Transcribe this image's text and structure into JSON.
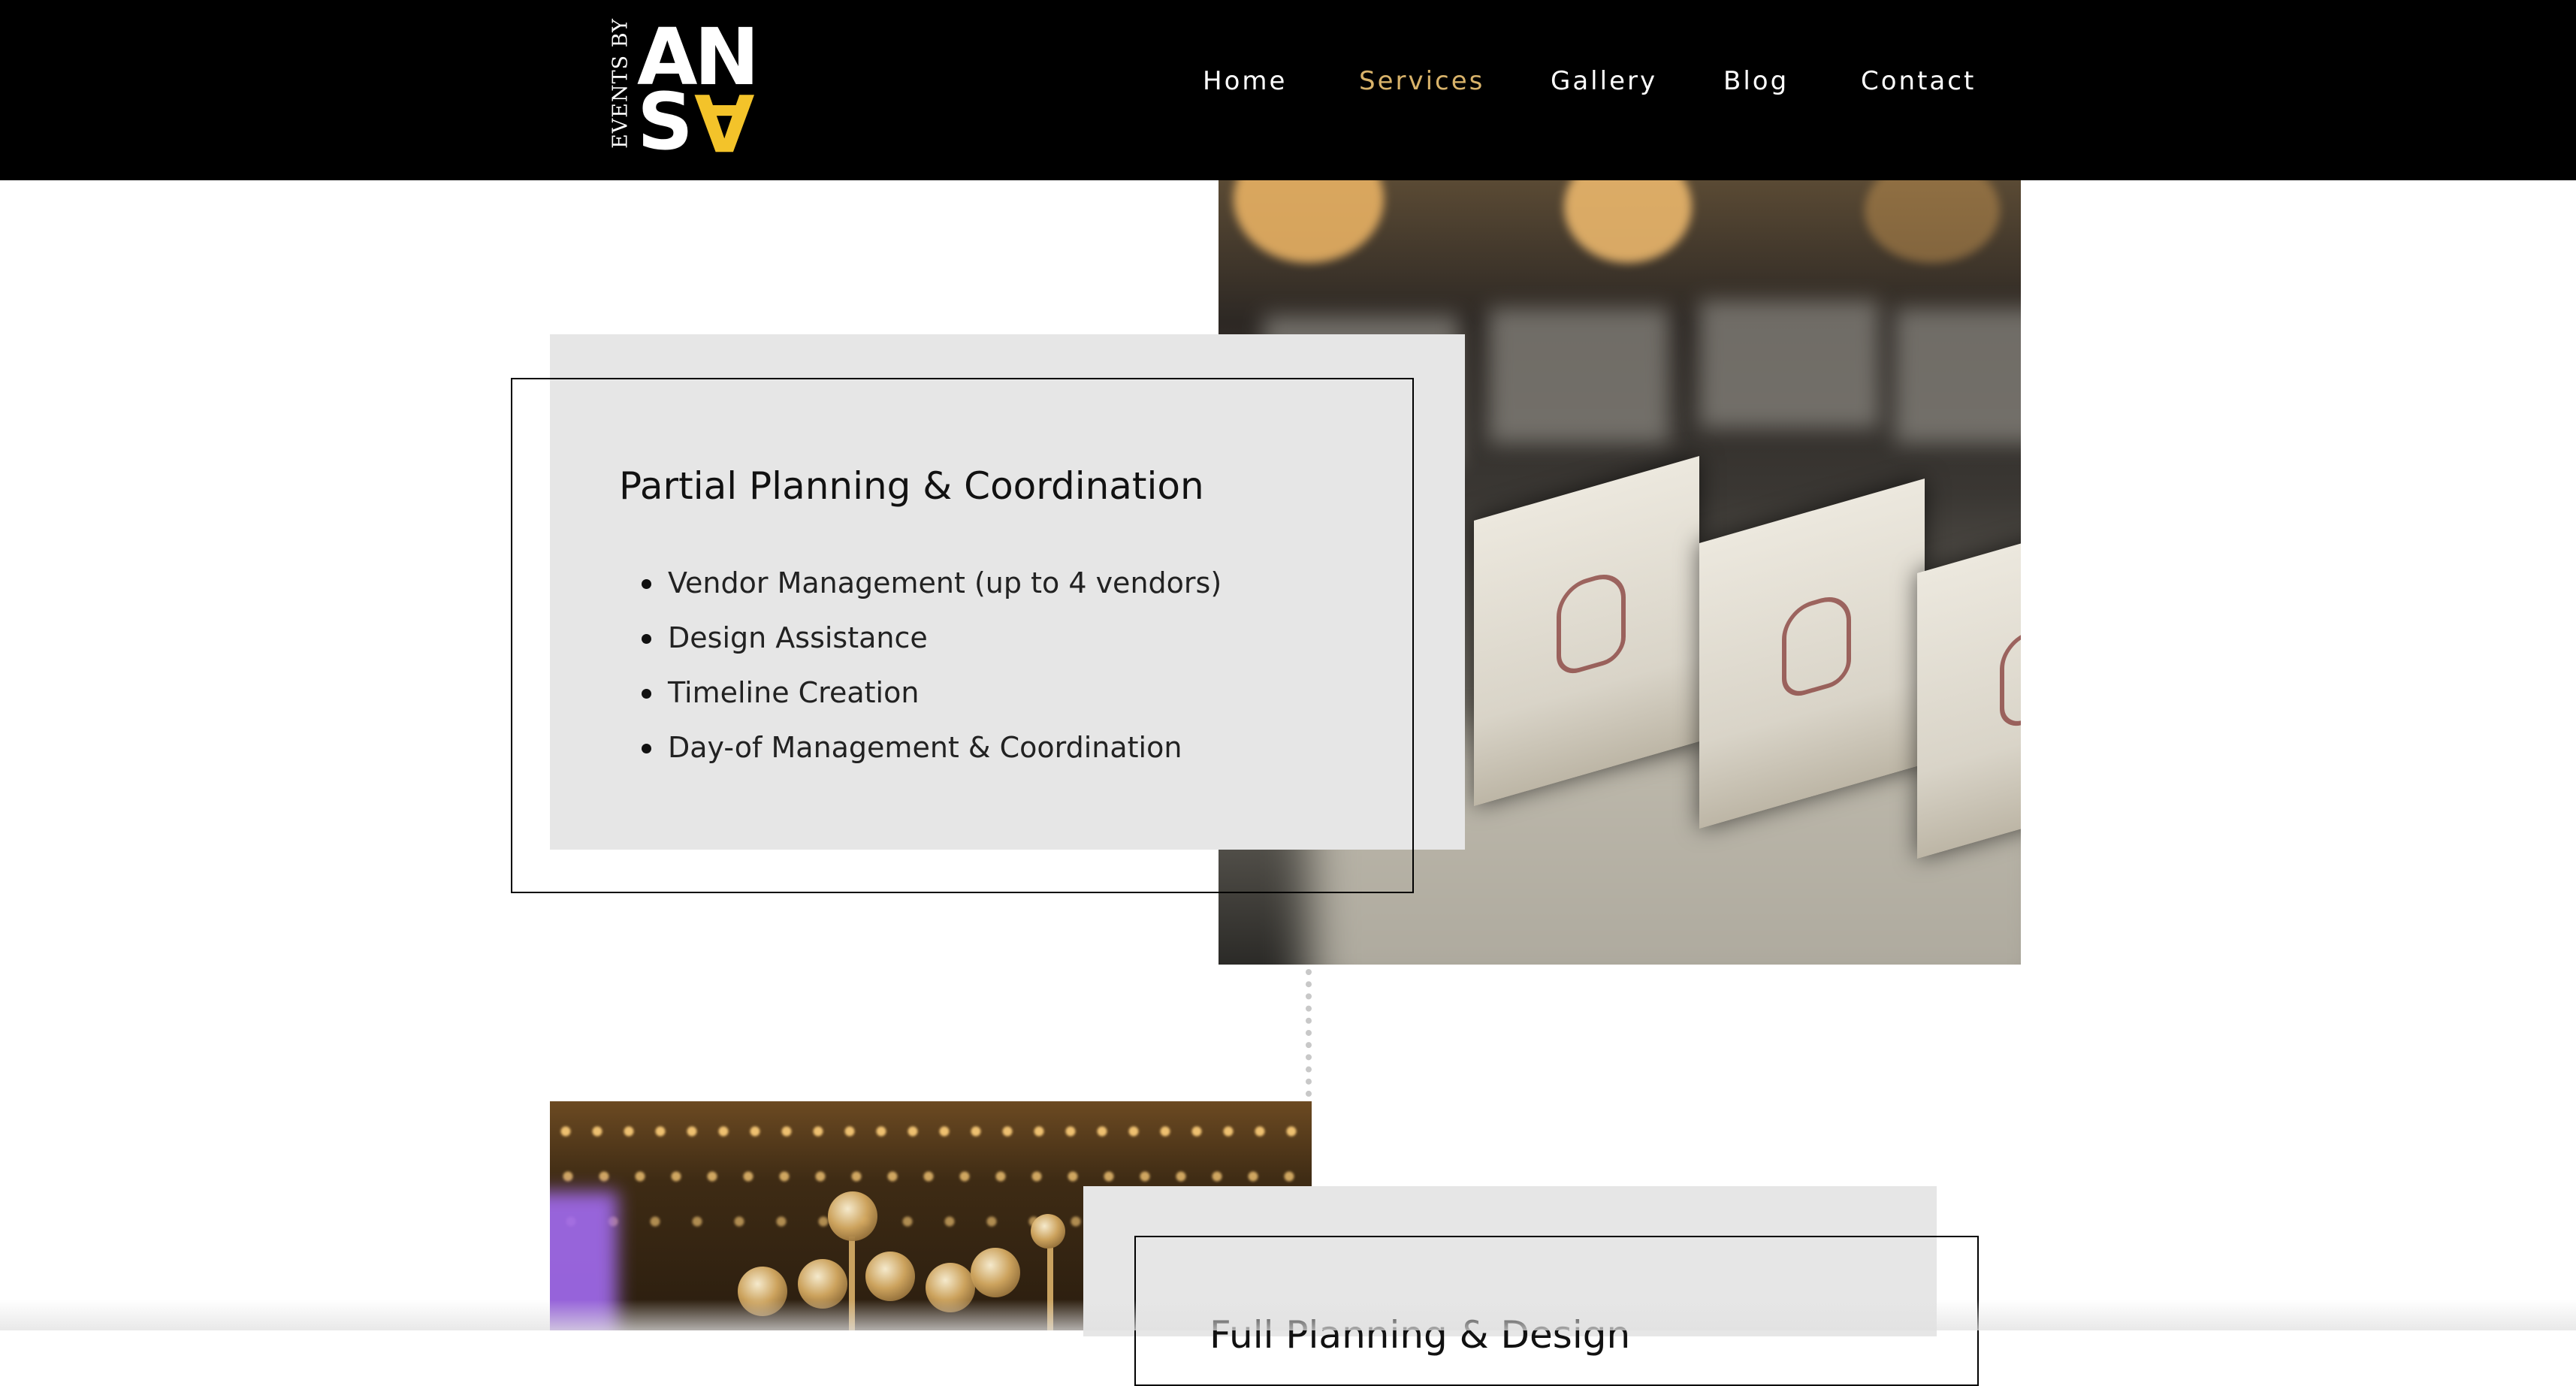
{
  "header": {
    "logo": {
      "vertical_text": "EVENTS BY",
      "letters": [
        "A",
        "N",
        "S",
        "A"
      ],
      "accent_color": "#f3c32a"
    },
    "nav": [
      {
        "label": "Home",
        "active": false
      },
      {
        "label": "Services",
        "active": true
      },
      {
        "label": "Gallery",
        "active": false
      },
      {
        "label": "Blog",
        "active": false
      },
      {
        "label": "Contact",
        "active": false
      }
    ],
    "active_color": "#d9b36a",
    "background": "#000000"
  },
  "services": [
    {
      "title": "Partial Planning & Coordination",
      "items": [
        "Vendor Management (up to 4 vendors)",
        "Design Assistance",
        "Timeline Creation",
        "Day-of Management & Coordination"
      ],
      "card_background": "#e6e6e6"
    },
    {
      "title": "Full Planning & Design"
    }
  ]
}
